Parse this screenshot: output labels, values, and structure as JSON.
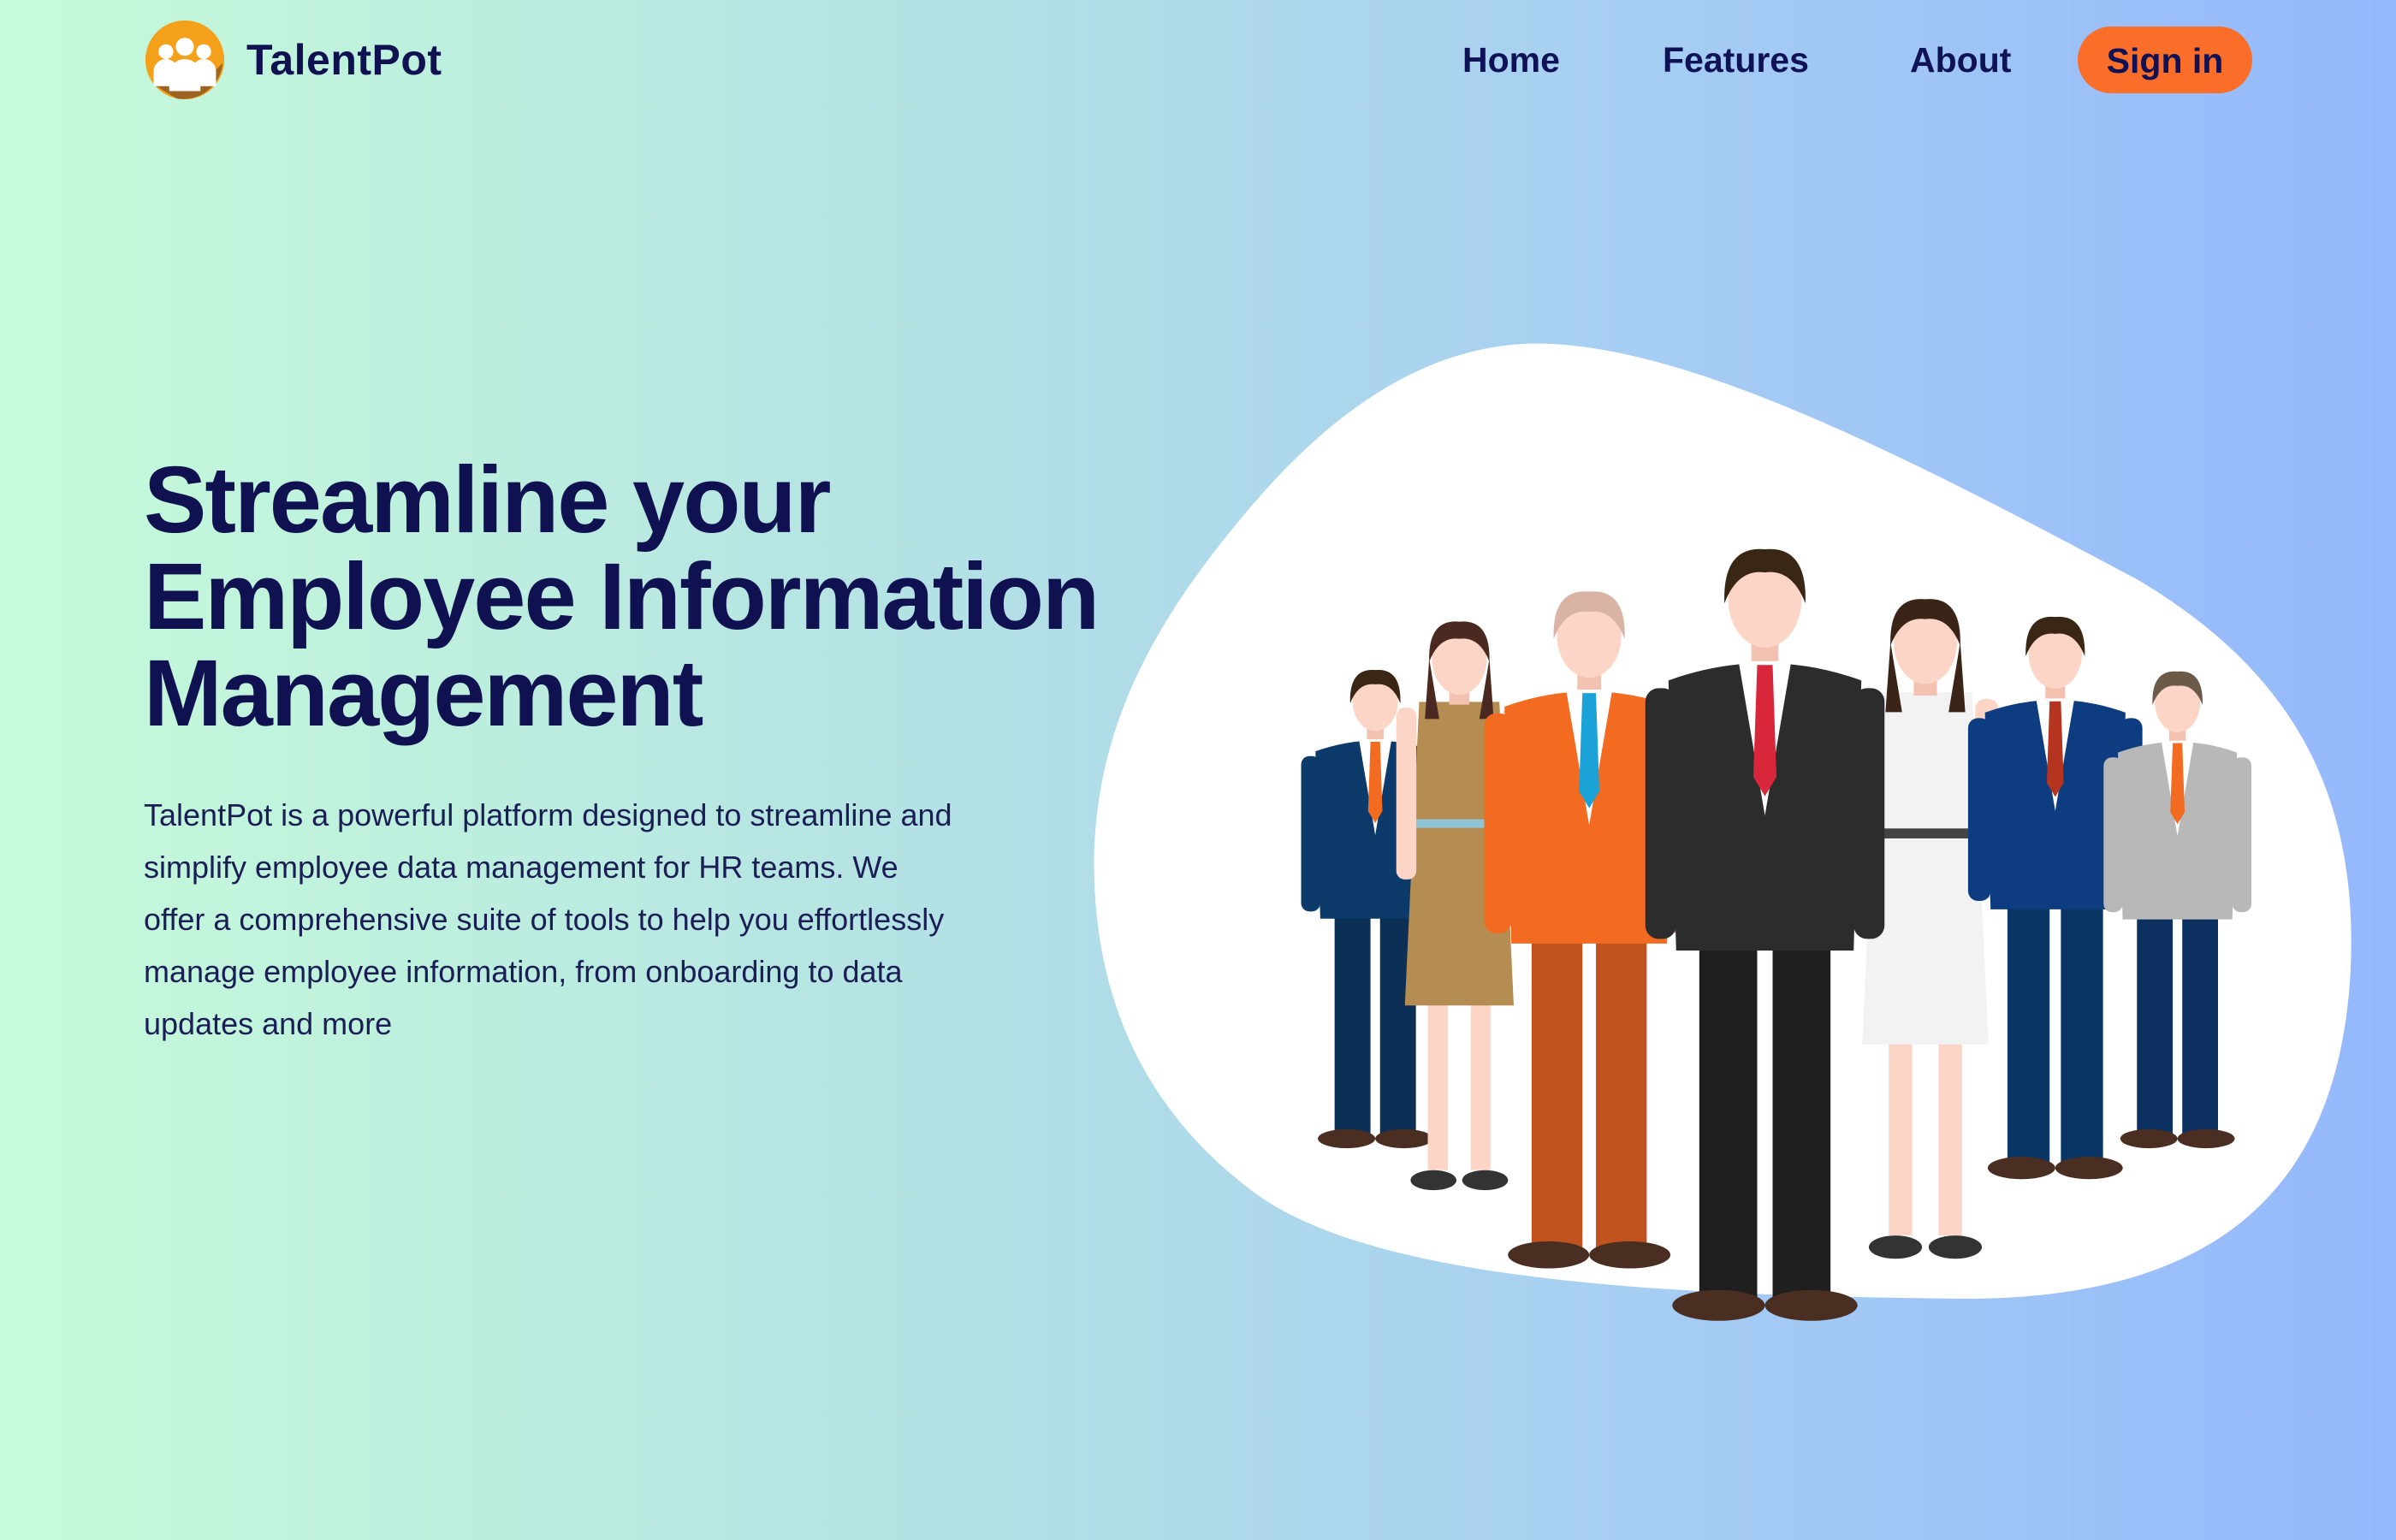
{
  "brand": {
    "name": "TalentPot",
    "logo_icon": "group-people-icon",
    "logo_color": "#f4a01a"
  },
  "nav": {
    "items": [
      {
        "label": "Home"
      },
      {
        "label": "Features"
      },
      {
        "label": "About"
      }
    ],
    "signin_label": "Sign in",
    "signin_color": "#fb6e29"
  },
  "hero": {
    "title_lines": [
      "Streamline your",
      "Employee Information",
      "Management"
    ],
    "description": "TalentPot is a powerful platform designed to streamline and simplify employee data management for HR teams. We offer a comprehensive suite of tools to help you effortlessly manage employee information, from onboarding to data updates and more",
    "illustration": "group-of-business-people"
  },
  "colors": {
    "text": "#0f1150",
    "gradient_start": "#c6fbd9",
    "gradient_end": "#94b8fc"
  }
}
